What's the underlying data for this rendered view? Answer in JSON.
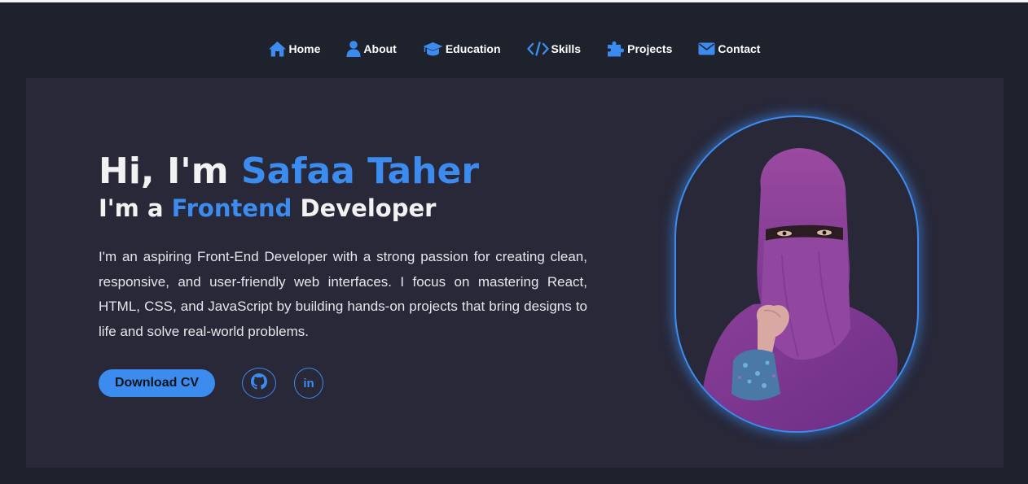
{
  "nav": {
    "items": [
      {
        "label": "Home",
        "icon": "home-icon"
      },
      {
        "label": "About",
        "icon": "user-icon"
      },
      {
        "label": "Education",
        "icon": "graduation-cap-icon"
      },
      {
        "label": "Skills",
        "icon": "code-icon"
      },
      {
        "label": "Projects",
        "icon": "puzzle-icon"
      },
      {
        "label": "Contact",
        "icon": "envelope-icon"
      }
    ]
  },
  "hero": {
    "greeting_prefix": "Hi, I'm ",
    "name": "Safaa Taher",
    "role_prefix": "I'm a ",
    "role_highlight": "Frontend",
    "role_suffix": " Developer",
    "bio": "I'm an aspiring Front-End Developer with a strong passion for creating clean, responsive, and user-friendly web interfaces. I focus on mastering React, HTML, CSS, and JavaScript by building hands-on projects that bring designs to life and solve real-world problems.",
    "cv_button": "Download CV",
    "social": [
      {
        "icon": "github-icon"
      },
      {
        "icon": "linkedin-icon",
        "text": "in"
      }
    ]
  },
  "colors": {
    "accent": "#3c8cf0",
    "page_bg": "#1e222c",
    "hero_bg": "#282839"
  }
}
